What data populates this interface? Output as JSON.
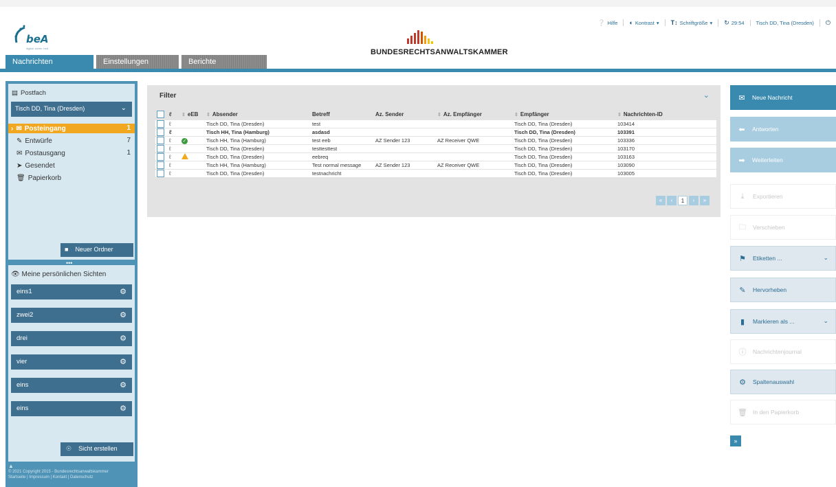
{
  "header": {
    "logo_text": "beA",
    "logo_subtext": "digital. sicher. beA",
    "org_name": "BUNDESRECHTSANWALTSKAMMER",
    "topbar": {
      "help": "Hilfe",
      "contrast": "Kontrast",
      "font_size": "Schriftgröße",
      "session_timer": "29:54",
      "user": "Tisch DD, Tina (Dresden)"
    }
  },
  "tabs": [
    {
      "label": "Nachrichten",
      "active": true
    },
    {
      "label": "Einstellungen",
      "active": false
    },
    {
      "label": "Berichte",
      "active": false
    }
  ],
  "sidebar": {
    "postfach_title": "Postfach",
    "postfach_selected": "Tisch DD, Tina (Dresden)",
    "folders": [
      {
        "label": "Posteingang",
        "count": "1",
        "active": true
      },
      {
        "label": "Entwürfe",
        "count": "7"
      },
      {
        "label": "Postausgang",
        "count": "1"
      },
      {
        "label": "Gesendet",
        "count": ""
      },
      {
        "label": "Papierkorb",
        "count": ""
      }
    ],
    "new_folder": "Neuer Ordner",
    "dots": "•••",
    "views_title": "Meine persönlichen Sichten",
    "views": [
      "eins1",
      "zwei2",
      "drei",
      "vier",
      "eins",
      "eins"
    ],
    "create_view": "Sicht erstellen",
    "footer": "© 2021 Copyright 2015 - Bundesrechtsanwaltskammer",
    "footer_links": "Startseite | Impressum | Kontakt | Datenschutz"
  },
  "main": {
    "filter_label": "Filter",
    "columns": [
      "eEB",
      "Absender",
      "Betreff",
      "Az. Sender",
      "Az. Empfänger",
      "Empfänger",
      "Nachrichten-ID"
    ],
    "rows": [
      {
        "eeb": "",
        "absender": "Tisch DD, Tina (Dresden)",
        "betreff": "test",
        "az_sender": "",
        "az_empfaenger": "",
        "empfaenger": "Tisch DD, Tina (Dresden)",
        "id": "103414",
        "unread": false
      },
      {
        "eeb": "",
        "absender": "Tisch HH, Tina (Hamburg)",
        "betreff": "asdasd",
        "az_sender": "",
        "az_empfaenger": "",
        "empfaenger": "Tisch DD, Tina (Dresden)",
        "id": "103391",
        "unread": true
      },
      {
        "eeb": "ok",
        "absender": "Tisch HH, Tina (Hamburg)",
        "betreff": "test eeb",
        "az_sender": "AZ Sender 123",
        "az_empfaenger": "AZ Receiver QWE",
        "empfaenger": "Tisch DD, Tina (Dresden)",
        "id": "103336",
        "unread": false
      },
      {
        "eeb": "",
        "absender": "Tisch DD, Tina (Dresden)",
        "betreff": "testtesttest",
        "az_sender": "",
        "az_empfaenger": "",
        "empfaenger": "Tisch DD, Tina (Dresden)",
        "id": "103170",
        "unread": false
      },
      {
        "eeb": "warn",
        "absender": "Tisch DD, Tina (Dresden)",
        "betreff": "eebreq",
        "az_sender": "",
        "az_empfaenger": "",
        "empfaenger": "Tisch DD, Tina (Dresden)",
        "id": "103163",
        "unread": false
      },
      {
        "eeb": "",
        "absender": "Tisch HH, Tina (Hamburg)",
        "betreff": "Test normal message",
        "az_sender": "AZ Sender 123",
        "az_empfaenger": "AZ Receiver QWE",
        "empfaenger": "Tisch DD, Tina (Dresden)",
        "id": "103090",
        "unread": false
      },
      {
        "eeb": "",
        "absender": "Tisch DD, Tina (Dresden)",
        "betreff": "testnachricht",
        "az_sender": "",
        "az_empfaenger": "",
        "empfaenger": "Tisch DD, Tina (Dresden)",
        "id": "103005",
        "unread": false
      }
    ],
    "pager": {
      "first": "«",
      "prev": "‹",
      "current": "1",
      "next": "›",
      "last": "»"
    }
  },
  "actions": [
    {
      "label": "Neue Nachricht",
      "style": "primary",
      "icon": "envelope-icon"
    },
    {
      "label": "Antworten",
      "style": "light",
      "icon": "reply-icon"
    },
    {
      "label": "Weiterleiten",
      "style": "light",
      "icon": "forward-icon"
    },
    {
      "label": "Exportieren",
      "style": "disabled",
      "icon": "download-icon"
    },
    {
      "label": "Verschieben",
      "style": "disabled",
      "icon": "folder-icon"
    },
    {
      "label": "Etiketten ...",
      "style": "normal",
      "icon": "tags-icon"
    },
    {
      "label": "Hervorheben",
      "style": "normal",
      "icon": "highlighter-icon"
    },
    {
      "label": "Markieren als ...",
      "style": "normal",
      "icon": "bookmark-icon"
    },
    {
      "label": "Nachrichtenjournal",
      "style": "disabled",
      "icon": "info-icon"
    },
    {
      "label": "Spaltenauswahl",
      "style": "normal",
      "icon": "gear-icon"
    },
    {
      "label": "In den Papierkorb",
      "style": "disabled",
      "icon": "trash-icon"
    }
  ],
  "expand_label": "»",
  "colors": {
    "brand_blue": "#3a8ab0",
    "dark_blue": "#3f6f8f",
    "active_orange": "#f1a820"
  }
}
